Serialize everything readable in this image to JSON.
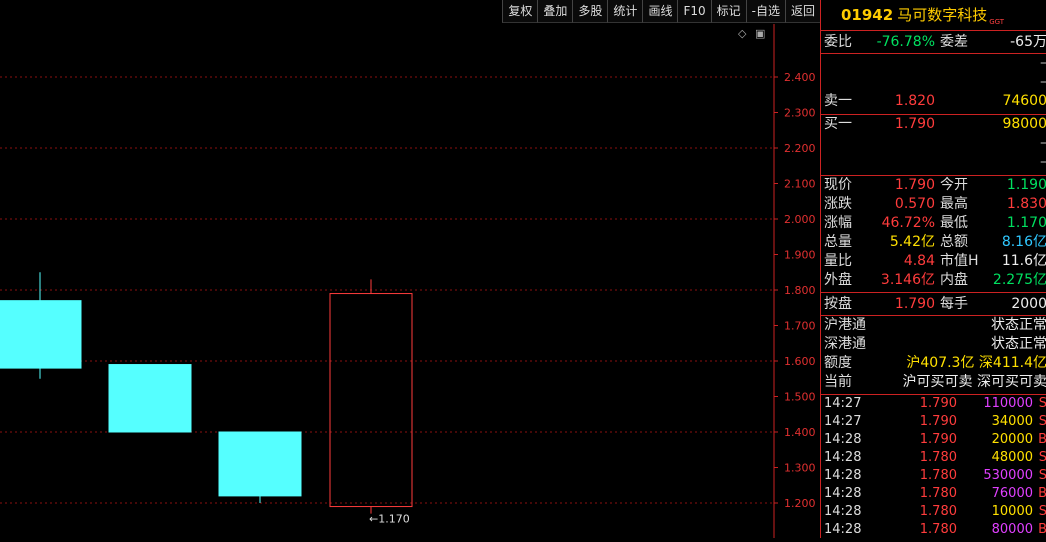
{
  "toolbar": {
    "buttons": [
      "复权",
      "叠加",
      "多股",
      "统计",
      "画线",
      "F10",
      "标记",
      "-自选",
      "返回"
    ]
  },
  "chart_data": {
    "type": "candlestick",
    "y_ticks": [
      "1.200",
      "1.300",
      "1.400",
      "1.500",
      "1.600",
      "1.700",
      "1.800",
      "1.900",
      "2.000",
      "2.100",
      "2.200",
      "2.300",
      "2.400"
    ],
    "ylim": [
      1.17,
      2.45
    ],
    "candles": [
      {
        "open": 1.58,
        "high": 1.85,
        "low": 1.55,
        "close": 1.77,
        "color": "cyan"
      },
      {
        "open": 1.59,
        "high": 1.59,
        "low": 1.4,
        "close": 1.4,
        "color": "cyan"
      },
      {
        "open": 1.4,
        "high": 1.4,
        "low": 1.2,
        "close": 1.22,
        "color": "cyan"
      },
      {
        "open": 1.19,
        "high": 1.83,
        "low": 1.17,
        "close": 1.79,
        "color": "red"
      }
    ],
    "low_annotation": "←1.170",
    "colors": {
      "up": "#ff3c3c",
      "down": "#55ffff",
      "grid": "#8a1010",
      "axis": "#c22"
    }
  },
  "quote": {
    "code": "01942",
    "name": "马可数字科技",
    "market_tag": "GGT",
    "weibi_label": "委比",
    "weibi_value": "-76.78%",
    "weicha_label": "委差",
    "weicha_value": "-65万",
    "sell_dashes": [
      "–",
      "–"
    ],
    "sell1_label": "卖一",
    "sell1_price": "1.820",
    "sell1_vol": "74600",
    "buy1_label": "买一",
    "buy1_price": "1.790",
    "buy1_vol": "98000",
    "buy_dashes": [
      "–",
      "–"
    ],
    "stats": [
      {
        "l1": "现价",
        "v1": "1.790",
        "c1": "red",
        "l2": "今开",
        "v2": "1.190",
        "c2": "green"
      },
      {
        "l1": "涨跌",
        "v1": "0.570",
        "c1": "red",
        "l2": "最高",
        "v2": "1.830",
        "c2": "red"
      },
      {
        "l1": "涨幅",
        "v1": "46.72%",
        "c1": "red",
        "l2": "最低",
        "v2": "1.170",
        "c2": "green"
      },
      {
        "l1": "总量",
        "v1": "5.42亿",
        "c1": "yellow",
        "l2": "总额",
        "v2": "8.16亿",
        "c2": "cyan"
      },
      {
        "l1": "量比",
        "v1": "4.84",
        "c1": "red",
        "l2": "市值H",
        "v2": "11.6亿",
        "c2": "white"
      },
      {
        "l1": "外盘",
        "v1": "3.146亿",
        "c1": "red",
        "l2": "内盘",
        "v2": "2.275亿",
        "c2": "green"
      }
    ],
    "anpan_label": "按盘",
    "anpan_value": "1.790",
    "meishou_label": "每手",
    "meishou_value": "2000",
    "hgt_label": "沪港通",
    "hgt_status": "状态正常",
    "sgt_label": "深港通",
    "sgt_status": "状态正常",
    "edu_label": "额度",
    "edu_value": "沪407.3亿 深411.4亿",
    "dangqian_label": "当前",
    "dangqian_value": "沪可买可卖 深可买可卖"
  },
  "trades": [
    {
      "time": "14:27",
      "price": "1.790",
      "vol": "110000",
      "vc": "magenta",
      "flag": "S"
    },
    {
      "time": "14:27",
      "price": "1.790",
      "vol": "34000",
      "vc": "yellow",
      "flag": "S"
    },
    {
      "time": "14:28",
      "price": "1.790",
      "vol": "20000",
      "vc": "yellow",
      "flag": "B"
    },
    {
      "time": "14:28",
      "price": "1.780",
      "vol": "48000",
      "vc": "yellow",
      "flag": "S"
    },
    {
      "time": "14:28",
      "price": "1.780",
      "vol": "530000",
      "vc": "magenta",
      "flag": "S"
    },
    {
      "time": "14:28",
      "price": "1.780",
      "vol": "76000",
      "vc": "magenta",
      "flag": "B"
    },
    {
      "time": "14:28",
      "price": "1.780",
      "vol": "10000",
      "vc": "yellow",
      "flag": "S"
    },
    {
      "time": "14:28",
      "price": "1.780",
      "vol": "80000",
      "vc": "magenta",
      "flag": "B"
    }
  ]
}
